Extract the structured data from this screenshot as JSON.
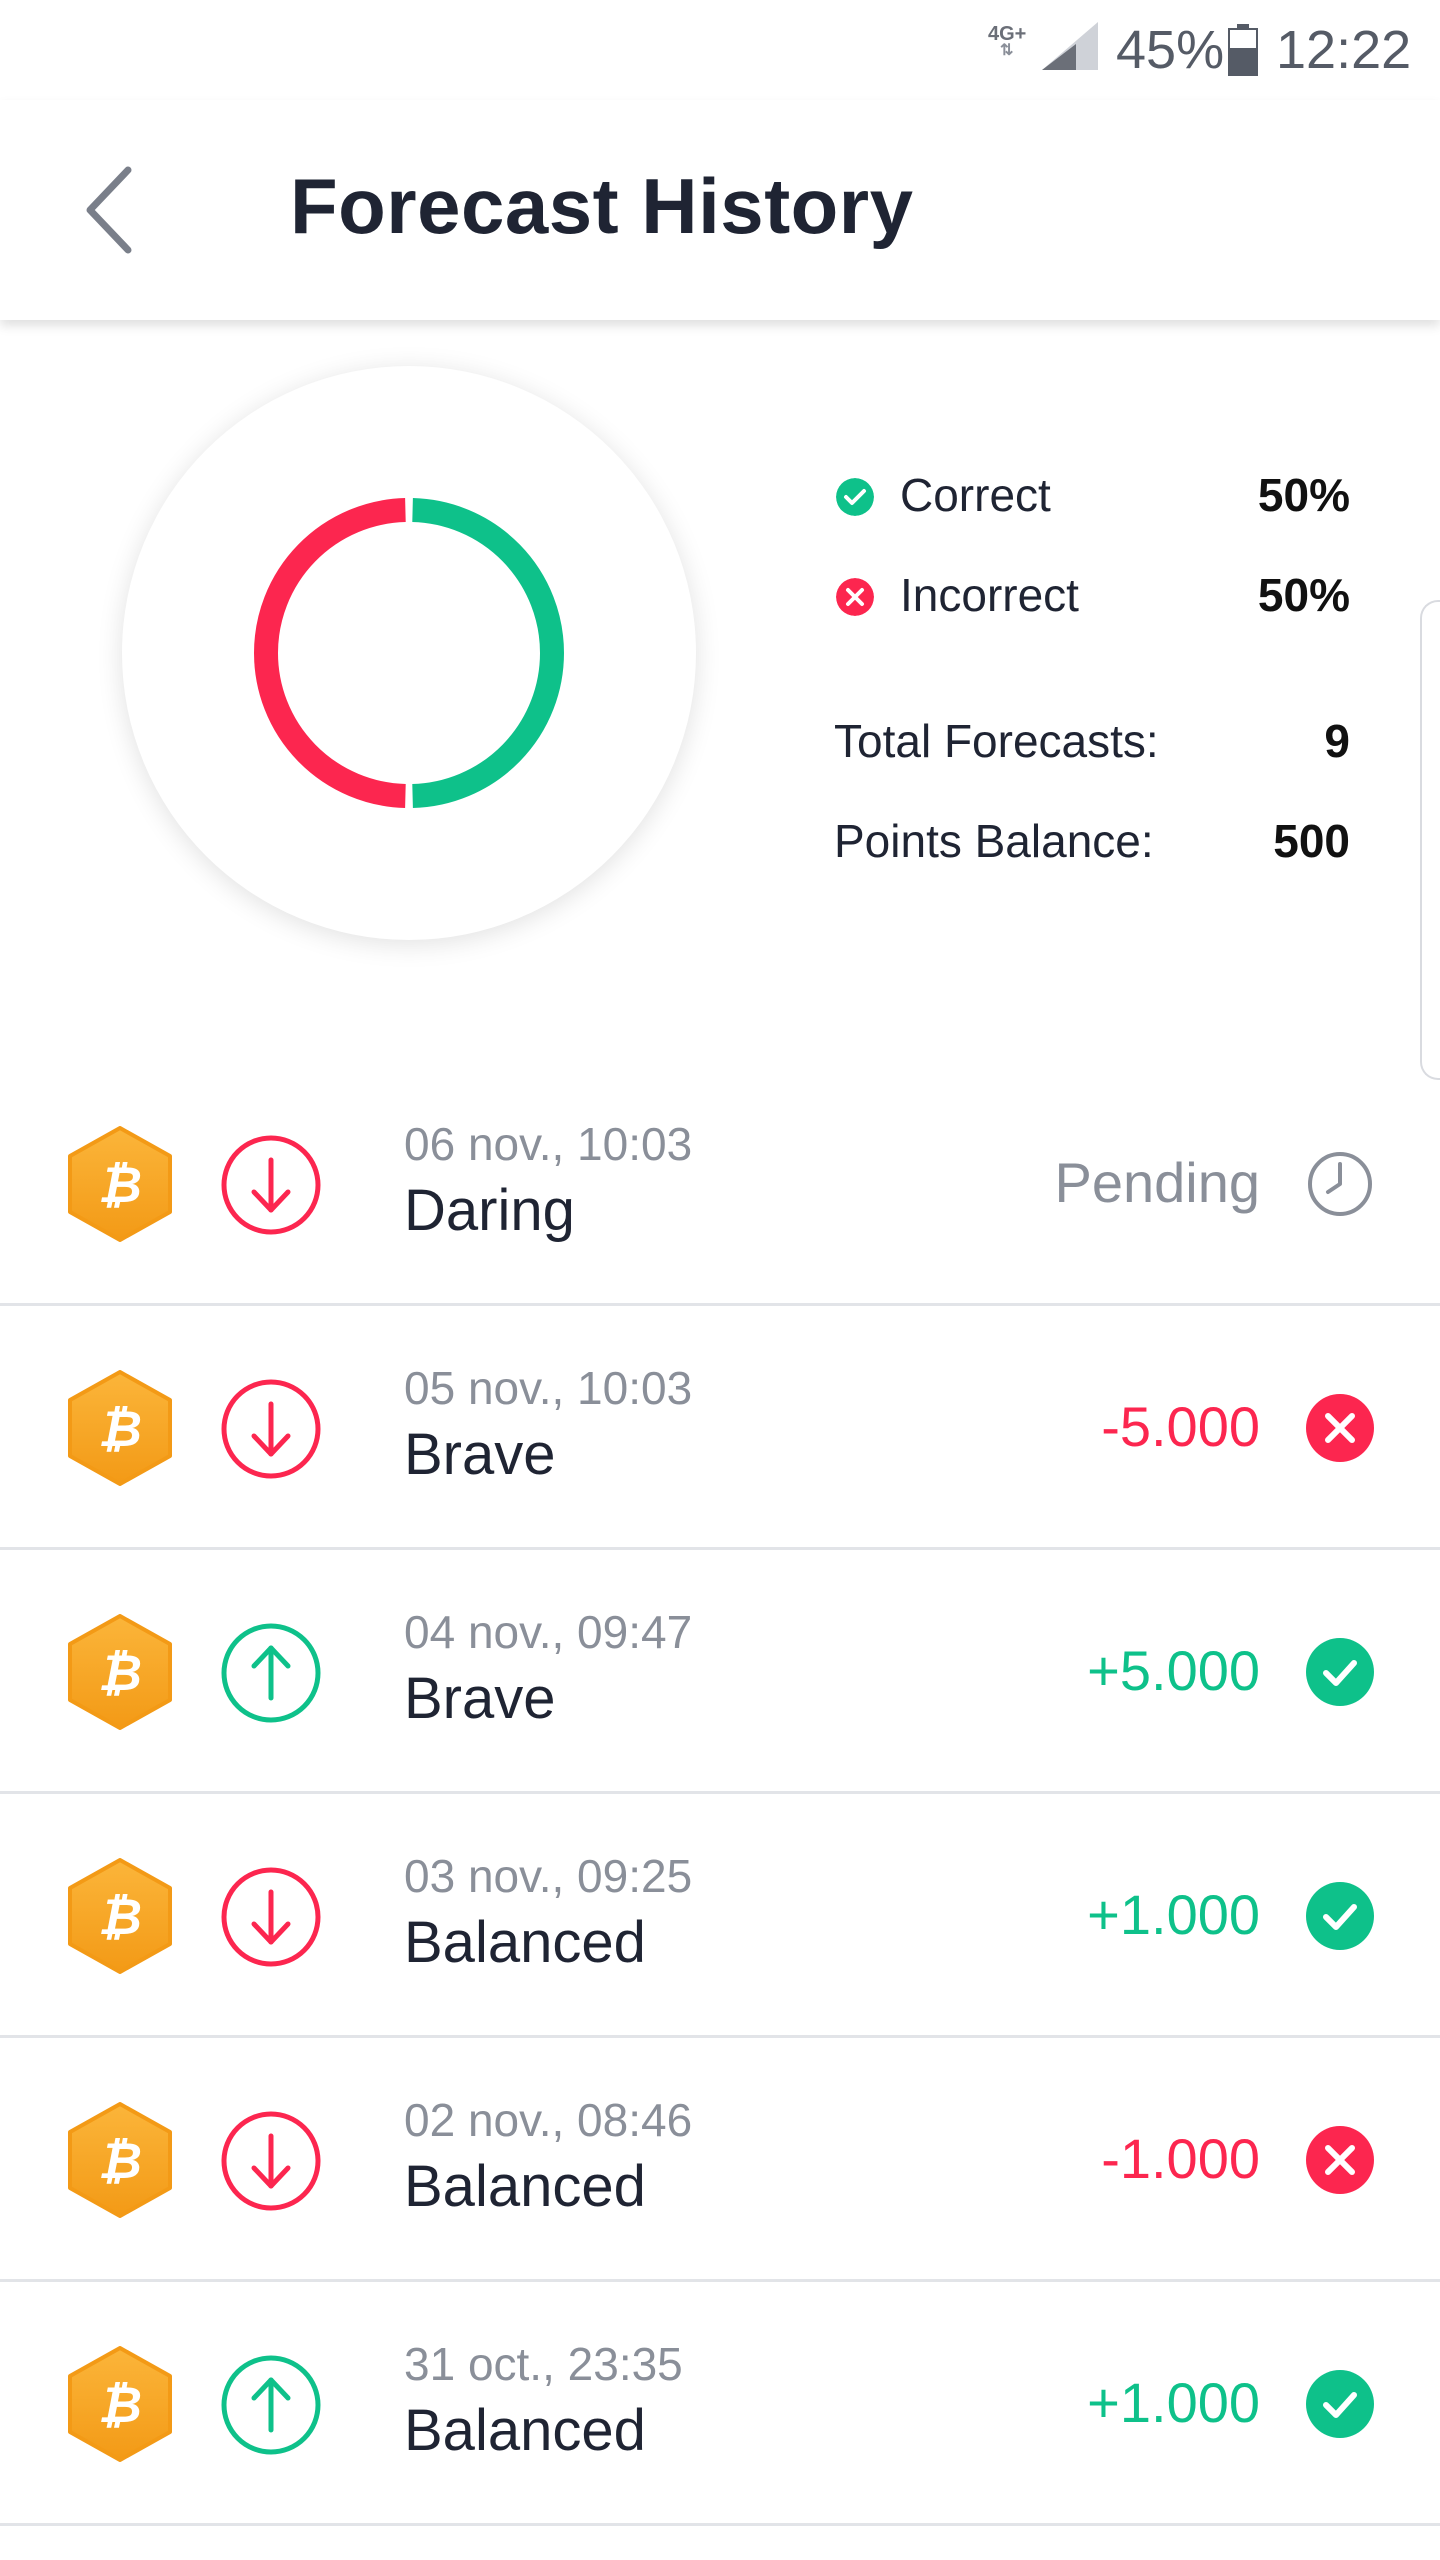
{
  "status_bar": {
    "network": "4G+",
    "battery_percent": "45%",
    "time": "12:22"
  },
  "header": {
    "title": "Forecast History"
  },
  "summary": {
    "correct_label": "Correct",
    "correct_value": "50%",
    "incorrect_label": "Incorrect",
    "incorrect_value": "50%",
    "total_label": "Total Forecasts:",
    "total_value": "9",
    "points_label": "Points Balance:",
    "points_value": "500",
    "correct_fraction": 0.5
  },
  "colors": {
    "correct": "#0ec18a",
    "incorrect": "#fc264f",
    "pending": "#8a8f99",
    "coin": "#f6a623"
  },
  "forecasts": [
    {
      "date": "06 nov., 10:03",
      "name": "Daring",
      "amount": "Pending",
      "direction": "down",
      "result": "pending"
    },
    {
      "date": "05 nov., 10:03",
      "name": "Brave",
      "amount": "-5.000",
      "direction": "down",
      "result": "incorrect"
    },
    {
      "date": "04 nov., 09:47",
      "name": "Brave",
      "amount": "+5.000",
      "direction": "up",
      "result": "correct"
    },
    {
      "date": "03 nov., 09:25",
      "name": "Balanced",
      "amount": "+1.000",
      "direction": "down",
      "result": "correct"
    },
    {
      "date": "02 nov., 08:46",
      "name": "Balanced",
      "amount": "-1.000",
      "direction": "down",
      "result": "incorrect"
    },
    {
      "date": "31 oct., 23:35",
      "name": "Balanced",
      "amount": "+1.000",
      "direction": "up",
      "result": "correct"
    }
  ],
  "icons": {
    "coin": "bitcoin-icon",
    "direction_up": "arrow-up-circle-icon",
    "direction_down": "arrow-down-circle-icon",
    "pending": "clock-icon",
    "correct": "check-circle-icon",
    "incorrect": "x-circle-icon"
  }
}
